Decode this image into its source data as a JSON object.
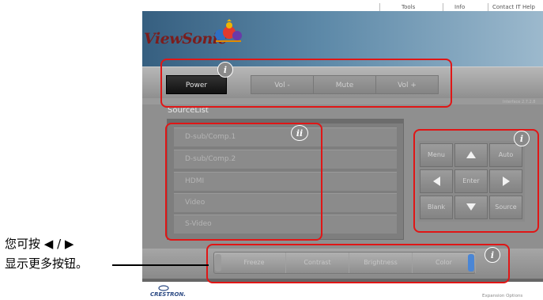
{
  "top_links": [
    "Tools",
    "Info",
    "Contact IT Help"
  ],
  "brand": {
    "logo_text": "ViewSonic"
  },
  "control_bar": {
    "power": "Power",
    "vol_down": "Vol -",
    "mute": "Mute",
    "vol_up": "Vol +"
  },
  "version": "Interface 2.7.2.8",
  "source_list": {
    "title": "SourceList",
    "items": [
      "D-sub/Comp.1",
      "D-sub/Comp.2",
      "HDMI",
      "Video",
      "S-Video"
    ]
  },
  "nav_pad": {
    "menu": "Menu",
    "auto": "Auto",
    "enter": "Enter",
    "blank": "Blank",
    "source": "Source"
  },
  "expansion": {
    "items": [
      "Freeze",
      "Contrast",
      "Brightness",
      "Color"
    ]
  },
  "footer": {
    "crestron": "CRESTRON.",
    "expansion_options": "Expansion Options"
  },
  "badges": {
    "i": "i",
    "ii": "ii"
  },
  "annotation": {
    "line1": "您可按 ◀ / ▶",
    "line2": "显示更多按钮。"
  },
  "colors": {
    "callout": "#e01616",
    "header_start": "#365f80",
    "header_end": "#9cb9cd",
    "logo": "#7a1d1d",
    "expand_arrow": "#4a86d6"
  }
}
